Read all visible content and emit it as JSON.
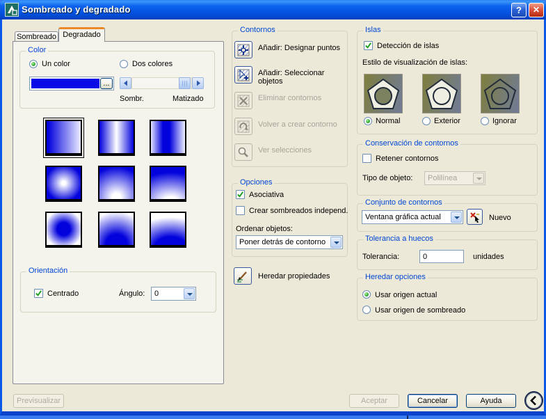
{
  "window": {
    "title": "Sombreado y degradado",
    "help_glyph": "?",
    "close_glyph": "✕"
  },
  "tabs": [
    {
      "label": "Sombreado",
      "active": false
    },
    {
      "label": "Degradado",
      "active": true
    }
  ],
  "color_group": {
    "title": "Color",
    "one_color": "Un color",
    "two_colors": "Dos colores",
    "browse_label": "...",
    "shade_label": "Sombr.",
    "tint_label": "Matizado",
    "swatch_color": "#0a0ae6"
  },
  "gradient_swatches": [
    {
      "name": "linear",
      "selected": true
    },
    {
      "name": "cylinder",
      "selected": false
    },
    {
      "name": "inverted-cylinder",
      "selected": false
    },
    {
      "name": "spherical",
      "selected": false
    },
    {
      "name": "hemispherical",
      "selected": false
    },
    {
      "name": "curved",
      "selected": false
    },
    {
      "name": "inverted-spherical",
      "selected": false
    },
    {
      "name": "inverted-hemispherical",
      "selected": false
    },
    {
      "name": "inverted-curved",
      "selected": false
    }
  ],
  "orientation_group": {
    "title": "Orientación",
    "centered_label": "Centrado",
    "centered_checked": true,
    "angle_label": "Ángulo:",
    "angle_value": "0"
  },
  "boundaries_group": {
    "title": "Contornos",
    "buttons": [
      {
        "label": "Añadir: Designar puntos",
        "enabled": true,
        "icon": "pick-points-icon"
      },
      {
        "label": "Añadir: Seleccionar objetos",
        "enabled": true,
        "icon": "select-objects-icon"
      },
      {
        "label": "Eliminar contornos",
        "enabled": false,
        "icon": "remove-boundaries-icon"
      },
      {
        "label": "Volver a crear contorno",
        "enabled": false,
        "icon": "recreate-boundary-icon"
      },
      {
        "label": "Ver selecciones",
        "enabled": false,
        "icon": "view-selections-icon"
      }
    ]
  },
  "options_group": {
    "title": "Opciones",
    "associative_label": "Asociativa",
    "associative_checked": true,
    "independent_label": "Crear sombreados independ.",
    "independent_checked": false,
    "draw_order_label": "Ordenar objetos:",
    "draw_order_value": "Poner detrás de contorno"
  },
  "inherit_properties": {
    "label": "Heredar propiedades"
  },
  "islands_group": {
    "title": "Islas",
    "detection_label": "Detección de islas",
    "detection_checked": true,
    "style_label": "Estilo de visualización de islas:",
    "styles": [
      {
        "label": "Normal",
        "selected": true
      },
      {
        "label": "Exterior",
        "selected": false
      },
      {
        "label": "Ignorar",
        "selected": false
      }
    ]
  },
  "retention_group": {
    "title": "Conservación de contornos",
    "retain_label": "Retener contornos",
    "retain_checked": false,
    "object_type_label": "Tipo de objeto:",
    "object_type_value": "Polilínea"
  },
  "boundary_set_group": {
    "title": "Conjunto de contornos",
    "set_value": "Ventana gráfica actual",
    "new_label": "Nuevo"
  },
  "tolerance_group": {
    "title": "Tolerancia a huecos",
    "tolerance_label": "Tolerancia:",
    "tolerance_value": "0",
    "units_label": "unidades"
  },
  "origin_group": {
    "title": "Heredar opciones",
    "current_label": "Usar origen actual",
    "hatch_label": "Usar origen de sombreado",
    "selected": "current"
  },
  "footer": {
    "preview_label": "Previsualizar",
    "ok_label": "Aceptar",
    "cancel_label": "Cancelar",
    "help_label": "Ayuda"
  },
  "colors": {
    "gradient_blue": "#0202dd",
    "groupbox_label_blue": "#0046d5",
    "titlebar_blue": "#0353e0",
    "dialog_bg": "#ece9d8"
  }
}
